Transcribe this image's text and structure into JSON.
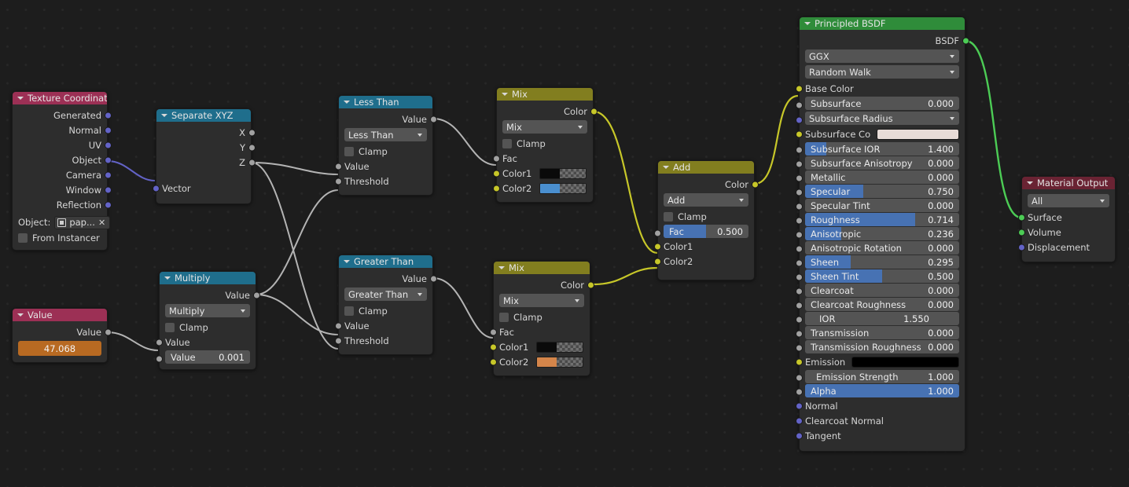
{
  "editor": {
    "background": "#1d1d1d",
    "grid_dot": "#272727"
  },
  "colors": {
    "header_texture": "#9c3055",
    "header_vector": "#1f6e8c",
    "header_converter": "#1f6e8c",
    "header_color": "#827e1f",
    "header_shader": "#2f8c3a",
    "header_output": "#6a2333",
    "socket_vector": "#6363c7",
    "socket_value": "#a1a1a1",
    "socket_color": "#c7c729",
    "socket_shader": "#4ccc55",
    "slider_fill": "#4772b3",
    "value_field": "#b86a22",
    "link_vector": "#6363c7",
    "link_value": "#b4b4b4",
    "link_color": "#c7c729",
    "link_shader": "#4ccc55"
  },
  "nodes": {
    "texture_coordinate": {
      "title": "Texture Coordinate",
      "outputs": [
        "Generated",
        "Normal",
        "UV",
        "Object",
        "Camera",
        "Window",
        "Reflection"
      ],
      "object_label": "Object:",
      "object_value": "pap...",
      "object_clear": "✕",
      "from_instancer": "From Instancer"
    },
    "separate_xyz": {
      "title": "Separate XYZ",
      "outputs": [
        "X",
        "Y",
        "Z"
      ],
      "inputs": [
        "Vector"
      ]
    },
    "value": {
      "title": "Value",
      "output": "Value",
      "field_value": "47.068"
    },
    "multiply": {
      "title": "Multiply",
      "output": "Value",
      "operation": "Multiply",
      "clamp": "Clamp",
      "input_linked": "Value",
      "input_field_label": "Value",
      "input_field_value": "0.001"
    },
    "less_than": {
      "title": "Less Than",
      "output": "Value",
      "operation": "Less Than",
      "clamp": "Clamp",
      "inputs": [
        "Value",
        "Threshold"
      ]
    },
    "greater_than": {
      "title": "Greater Than",
      "output": "Value",
      "operation": "Greater Than",
      "clamp": "Clamp",
      "inputs": [
        "Value",
        "Threshold"
      ]
    },
    "mix_top": {
      "title": "Mix",
      "output": "Color",
      "blend_mode": "Mix",
      "clamp": "Clamp",
      "fac": "Fac",
      "color1_label": "Color1",
      "color1_value": "#0a0a0a",
      "color2_label": "Color2",
      "color2_value": "#4a8fcf"
    },
    "mix_bottom": {
      "title": "Mix",
      "output": "Color",
      "blend_mode": "Mix",
      "clamp": "Clamp",
      "fac": "Fac",
      "color1_label": "Color1",
      "color1_value": "#0a0a0a",
      "color2_label": "Color2",
      "color2_value": "#d4854a"
    },
    "add": {
      "title": "Add",
      "output": "Color",
      "blend_mode": "Add",
      "clamp": "Clamp",
      "fac_label": "Fac",
      "fac_value": "0.500",
      "fac_fill_pct": 50,
      "color1_label": "Color1",
      "color2_label": "Color2"
    },
    "principled_bsdf": {
      "title": "Principled BSDF",
      "output": "BSDF",
      "distribution": "GGX",
      "subsurface_method": "Random Walk",
      "base_color_label": "Base Color",
      "subsurface_radius_label": "Subsurface Radius",
      "subsurface_color_label": "Subsurface Co",
      "subsurface_color_value": "#e8dcd7",
      "emission_label": "Emission",
      "emission_color_value": "#000000",
      "sliders": [
        {
          "label": "Subsurface",
          "value": "0.000",
          "fill": 0
        },
        {
          "label": "Subsurface IOR",
          "value": "1.400",
          "fill": 14
        },
        {
          "label": "Subsurface Anisotropy",
          "value": "0.000",
          "fill": 0
        },
        {
          "label": "Metallic",
          "value": "0.000",
          "fill": 0
        },
        {
          "label": "Specular",
          "value": "0.750",
          "fill": 37.5
        },
        {
          "label": "Specular Tint",
          "value": "0.000",
          "fill": 0
        },
        {
          "label": "Roughness",
          "value": "0.714",
          "fill": 71.4
        },
        {
          "label": "Anisotropic",
          "value": "0.236",
          "fill": 23.6
        },
        {
          "label": "Anisotropic Rotation",
          "value": "0.000",
          "fill": 0
        },
        {
          "label": "Sheen",
          "value": "0.295",
          "fill": 29.5
        },
        {
          "label": "Sheen Tint",
          "value": "0.500",
          "fill": 50
        },
        {
          "label": "Clearcoat",
          "value": "0.000",
          "fill": 0
        },
        {
          "label": "Clearcoat Roughness",
          "value": "0.000",
          "fill": 0
        },
        {
          "label": "IOR",
          "value": "1.550",
          "fill": 0,
          "centered": true
        },
        {
          "label": "Transmission",
          "value": "0.000",
          "fill": 0
        },
        {
          "label": "Transmission Roughness",
          "value": "0.000",
          "fill": 0
        }
      ],
      "emission_strength": {
        "label": "Emission Strength",
        "value": "1.000",
        "fill": 0,
        "centered": true
      },
      "alpha": {
        "label": "Alpha",
        "value": "1.000",
        "fill": 100
      },
      "vector_inputs": [
        "Normal",
        "Clearcoat Normal",
        "Tangent"
      ]
    },
    "material_output": {
      "title": "Material Output",
      "target": "All",
      "inputs": [
        "Surface",
        "Volume",
        "Displacement"
      ]
    }
  }
}
